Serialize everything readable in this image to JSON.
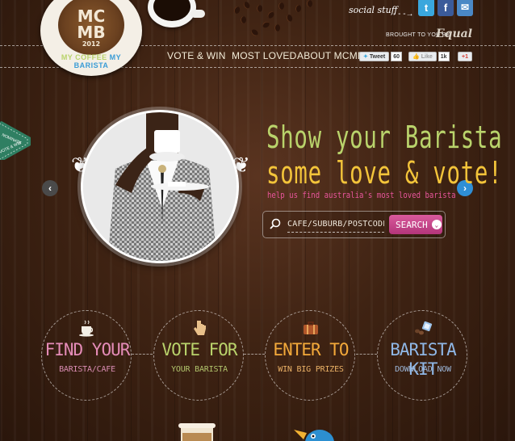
{
  "header": {
    "logo": {
      "line1": "MC",
      "line2": "MB",
      "year": "2012",
      "ring_my_coffee": "MY COFFEE",
      "ring_my_barista": "MY BARISTA"
    },
    "social_label": "social stuff",
    "social_buttons": [
      {
        "icon": "twitter-icon",
        "glyph": "t",
        "color": "#3aa7dd"
      },
      {
        "icon": "facebook-icon",
        "glyph": "f",
        "color": "#3b5b9a"
      },
      {
        "icon": "email-icon",
        "glyph": "✉",
        "color": "#4a88c5"
      }
    ],
    "brought_to_you_by": "BROUGHT TO YOU BY",
    "brand": "Equal",
    "nav": [
      "VOTE & WIN",
      "MOST LOVED",
      "ABOUT MCMB"
    ],
    "share": {
      "tweet_label": "Tweet",
      "tweet_count": "60",
      "like_label": "Like",
      "like_count": "1k",
      "gplus_label": "+1"
    }
  },
  "ribbon": {
    "line1": "NOMINATE",
    "line2": "VOTE & WIN"
  },
  "hero": {
    "headline_line1": "Show your Barista",
    "headline_line2": "some love & vote!",
    "tagline": "help us find australia's most loved barista",
    "search": {
      "placeholder": "CAFE/SUBURB/POSTCODE",
      "button_label": "SEARCH"
    },
    "colors": {
      "line1": "#b9d36b",
      "line2": "#f3c43a",
      "tagline": "#e7559a"
    }
  },
  "steps": [
    {
      "icon": "coffee-cup-icon",
      "title": "FIND YOUR",
      "subtitle": "BARISTA/CAFE",
      "title_color": "#e58cb8",
      "subtitle_color": "#d98cb2"
    },
    {
      "icon": "hand-pointer-icon",
      "title": "VOTE FOR",
      "subtitle": "YOUR BARISTA",
      "title_color": "#b9d36b",
      "subtitle_color": "#b1c46c"
    },
    {
      "icon": "suitcase-icon",
      "title": "ENTER TO",
      "subtitle": "WIN BIG PRIZES",
      "title_color": "#f3a93a",
      "subtitle_color": "#eab166"
    },
    {
      "icon": "coffee-beans-icon",
      "title": "BARISTA KIT",
      "subtitle": "DOWNLOAD NOW",
      "title_color": "#8fb7e6",
      "subtitle_color": "#9cb6d8"
    }
  ]
}
